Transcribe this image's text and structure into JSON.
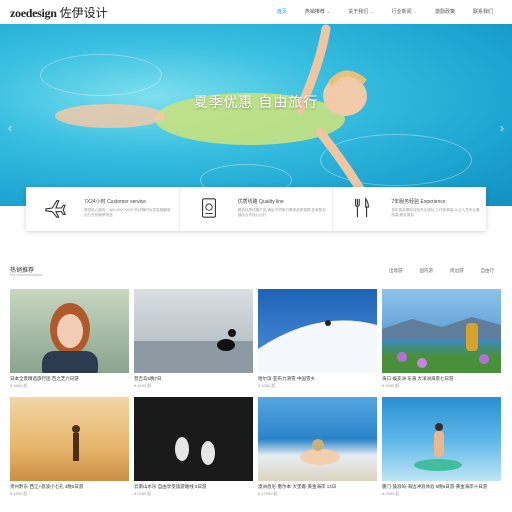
{
  "header": {
    "logo_brand": "zoedesign",
    "logo_cn": "佐伊设计",
    "nav": [
      {
        "label": "首页",
        "active": true,
        "caret": false
      },
      {
        "label": "热销推荐",
        "active": false,
        "caret": true
      },
      {
        "label": "关于我们",
        "active": false,
        "caret": true
      },
      {
        "label": "行业新闻",
        "active": false,
        "caret": true
      },
      {
        "label": "激励政策",
        "active": false,
        "caret": false
      },
      {
        "label": "联系我们",
        "active": false,
        "caret": false
      }
    ]
  },
  "hero": {
    "caption": "夏季优惠 自由旅行",
    "prev": "‹",
    "next": "›"
  },
  "features": [
    {
      "icon": "airplane-icon",
      "title": "7X24小时 Customer service",
      "desc": "提供贴心服务：400-0000-0000 热线随时为您答疑解惑出行无忧畅享旅途"
    },
    {
      "icon": "passport-icon",
      "title": "优质线路 Quality line",
      "desc": "精选优质线路产品 满足不同旅行需求品质保障 多家知名酒店合作放心出行"
    },
    {
      "icon": "dining-icon",
      "title": "7年服务经验 Experience",
      "desc": "多年旅游服务经验专业团队 工作效率高 从业人员专业素质高 服务周到"
    }
  ],
  "section": {
    "title": "热销推荐",
    "subtitle": "Hot recommendation",
    "filters": [
      "出境游",
      "国内游",
      "周边游",
      "自由行"
    ]
  },
  "cards": [
    {
      "title": "日本全景精选旅行团 百之芝六日游",
      "price": "¥ 4880 起"
    },
    {
      "title": "普吉岛5晚7日",
      "price": "¥ 6180 起"
    },
    {
      "title": "哈尔滨·亚布力滑雪·中国雪乡",
      "price": "¥ 3280 起"
    },
    {
      "title": "海口·蜈支洲 东海 大洋洲海景七日游",
      "price": "¥ 5980 起"
    },
    {
      "title": "贵州黔东·西江+荔波小七孔 4晚5日游",
      "price": "¥ 1590 起"
    },
    {
      "title": "云南山水乐 自由享受旅游路线 5日游",
      "price": "¥ 2180 起"
    },
    {
      "title": "澳洲悉尼·墨尔本·大堡礁·黄金海岸 14日",
      "price": "¥ 17999 起"
    },
    {
      "title": "厦门·鼓浪屿·海边冲浪体验 5晚6日游·黄金海岸十日游",
      "price": "¥ 2590 起"
    }
  ]
}
